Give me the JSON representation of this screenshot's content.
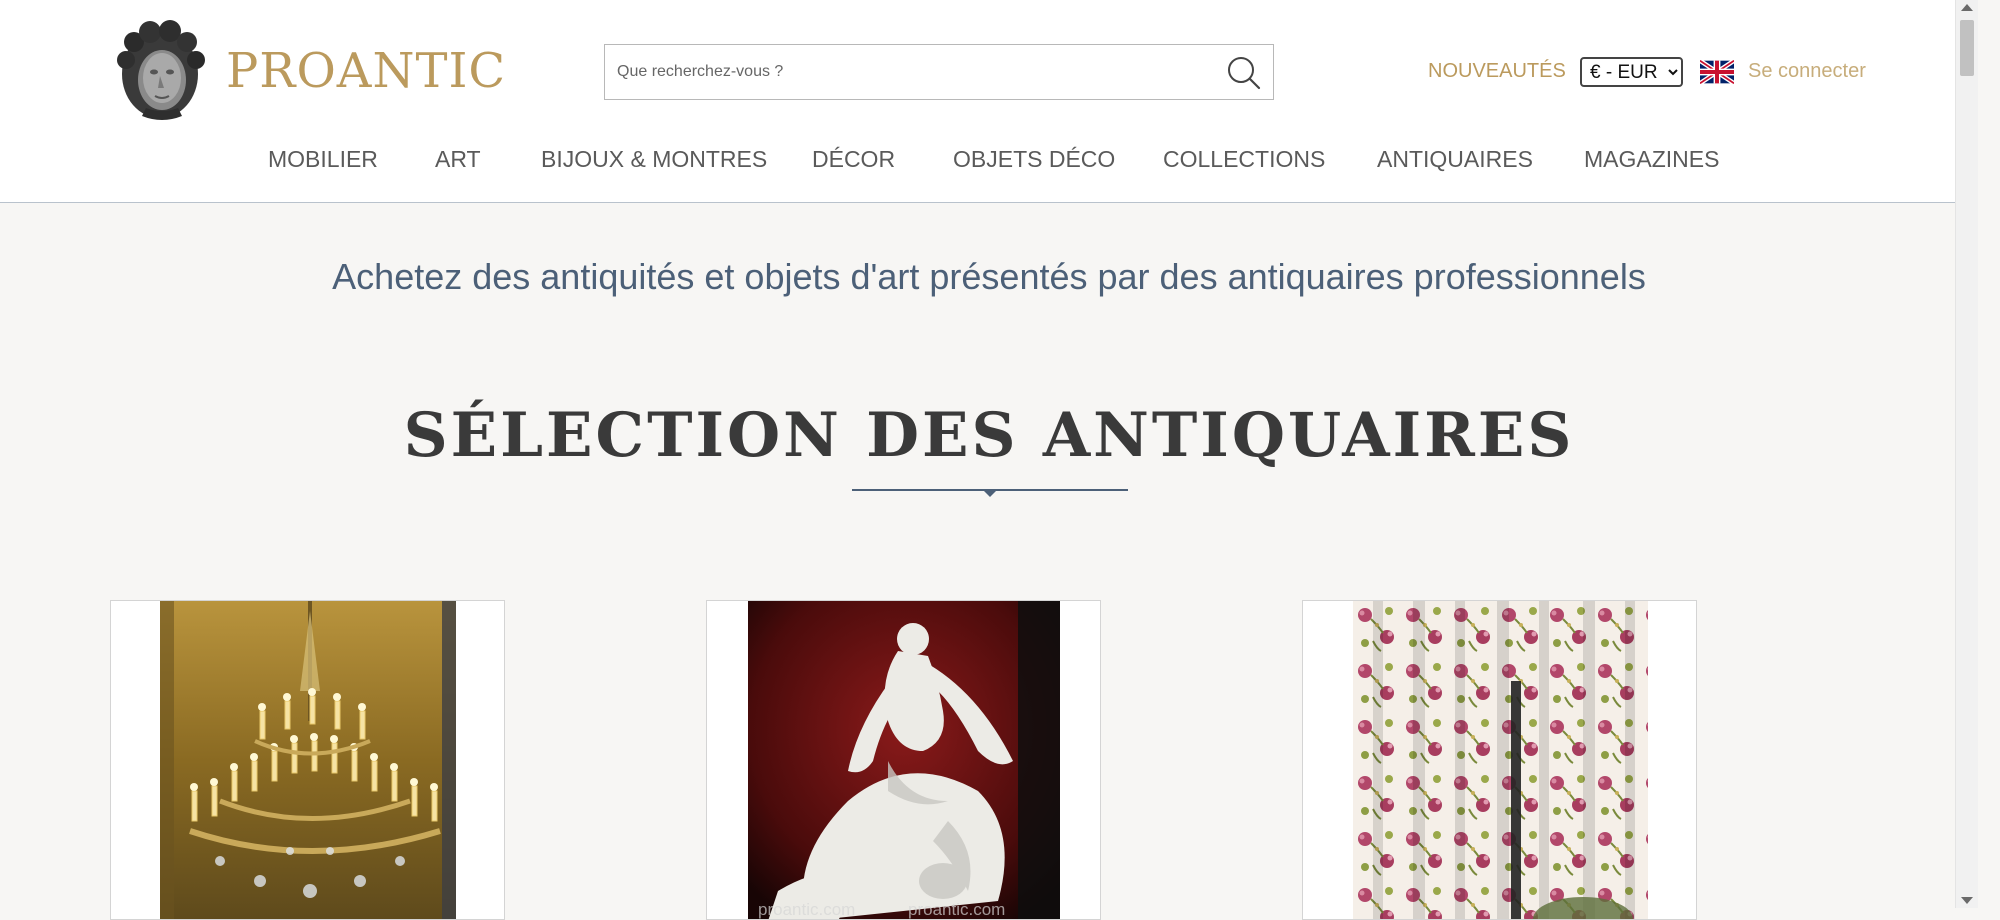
{
  "header": {
    "brand": "PROANTIC",
    "search_placeholder": "Que recherchez-vous ?",
    "nouveautes_label": "NOUVEAUTÉS",
    "currency_selected": "€ - EUR",
    "language_flag": "uk-flag-icon",
    "login_label": "Se connecter"
  },
  "nav": {
    "items": [
      {
        "label": "MOBILIER"
      },
      {
        "label": "ART"
      },
      {
        "label": "BIJOUX & MONTRES"
      },
      {
        "label": "DÉCOR"
      },
      {
        "label": "OBJETS DÉCO"
      },
      {
        "label": "COLLECTIONS"
      },
      {
        "label": "ANTIQUAIRES"
      },
      {
        "label": "MAGAZINES"
      }
    ]
  },
  "main": {
    "tagline": "Achetez des antiquités et objets d'art présentés par des antiquaires professionnels",
    "section_title": "SÉLECTION DES ANTIQUAIRES",
    "watermark": "proantic.com"
  },
  "colors": {
    "brand_gold": "#bb9a5d",
    "tagline_blue": "#4c6078",
    "page_bg": "#f7f6f4"
  }
}
